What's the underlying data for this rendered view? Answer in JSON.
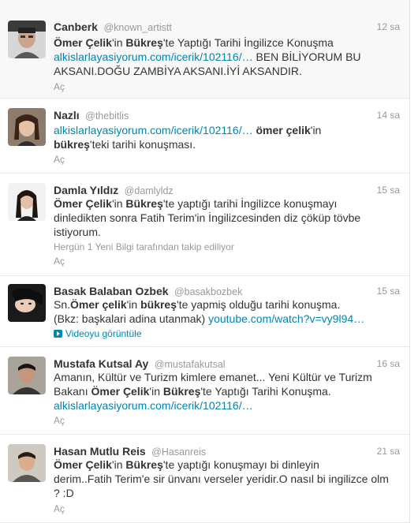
{
  "tweets": [
    {
      "fullname": "Canberk",
      "username": "@known_artistt",
      "time": "12 sa",
      "line1": [
        "Ömer Çelik",
        "'in ",
        "Bükreş",
        "'te Yaptığı Tarihi İngilizce Konuşma"
      ],
      "link": "alkislarlayasiyorum.com/icerik/102116/…",
      "line2_rest": " BEN BİLİYORUM BU",
      "line3": "AKSANI.DOĞU ZAMBİYA AKSANI.İYİ AKSANDIR.",
      "open": "Aç"
    },
    {
      "fullname": "Nazlı",
      "username": "@thebitlis",
      "time": "14 sa",
      "link": "alkislarlayasiyorum.com/icerik/102116/…",
      "line1_b": "ömer çelik",
      "line1_rest": "'in",
      "line2_b": "bükreş",
      "line2_rest": "'teki tarihi konuşması.",
      "open": "Aç"
    },
    {
      "fullname": "Damla Yıldız",
      "username": "@damlyldz",
      "time": "15 sa",
      "line1": [
        "Ömer Çelik",
        "'in ",
        "Bükreş",
        "'te yaptığı tarihi İngilizce konuşmayı"
      ],
      "line2": "dinledikten sonra Fatih Terim'in İngilizcesinden diz çöküp tövbe",
      "line3": "istiyorum.",
      "followed": "Hergün 1 Yeni Bilgi tarafından takip ediliyor",
      "open": "Aç"
    },
    {
      "fullname": "Basak Balaban Ozbek",
      "username": "@basakbozbek",
      "time": "15 sa",
      "line1": [
        "Sn.",
        "Ömer çelik",
        "'in ",
        "bükreş",
        "'te yapmiş olduğu tarihi konuşma."
      ],
      "line2": "(Bkz: başkalari adina utanmak) ",
      "link": "youtube.com/watch?v=vy9l94…",
      "video": "Videoyu görüntüle"
    },
    {
      "fullname": "Mustafa Kutsal Ay",
      "username": "@mustafakutsal",
      "time": "16 sa",
      "line1": "Amanın, Kültür ve Turizm kimlere emanet... Yeni Kültür ve Turizm",
      "line2": [
        "Bakanı ",
        "Ömer Çelik",
        "'in ",
        "Bükreş",
        "'te Yaptığı Tarihi Konuşma."
      ],
      "link": "alkislarlayasiyorum.com/icerik/102116/…",
      "open": "Aç"
    },
    {
      "fullname": "Hasan Mutlu Reis",
      "username": "@Hasanreis",
      "time": "21 sa",
      "line1": [
        "Ömer Çelik",
        "'in ",
        "Bükreş",
        "'te yaptığı konuşmayı bi dinleyin"
      ],
      "line2": "derim..Fatih Terim'e sir ünvanı verseler yeridir.O nasıl bi ingilizce olm",
      "line3": "? :D",
      "open": "Aç"
    }
  ]
}
